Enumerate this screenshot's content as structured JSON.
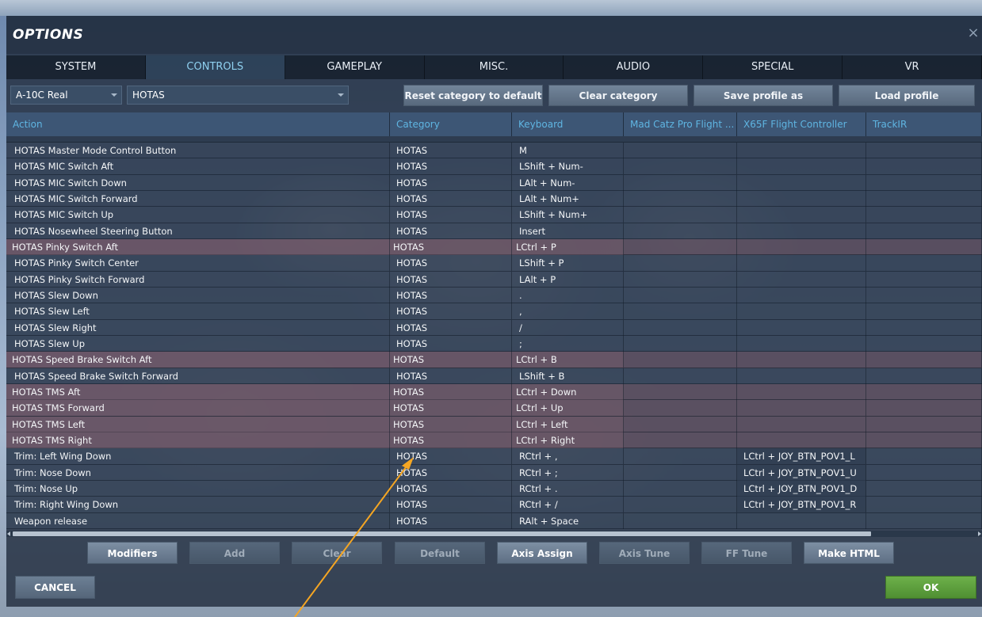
{
  "window": {
    "title": "OPTIONS",
    "close_glyph": "×"
  },
  "tabs": [
    {
      "label": "SYSTEM",
      "active": false
    },
    {
      "label": "CONTROLS",
      "active": true
    },
    {
      "label": "GAMEPLAY",
      "active": false
    },
    {
      "label": "MISC.",
      "active": false
    },
    {
      "label": "AUDIO",
      "active": false
    },
    {
      "label": "SPECIAL",
      "active": false
    },
    {
      "label": "VR",
      "active": false
    }
  ],
  "toolbar": {
    "aircraft": "A-10C Real",
    "category": "HOTAS",
    "reset_label": "Reset category to default",
    "clear_category_label": "Clear category",
    "save_profile_label": "Save profile as",
    "load_profile_label": "Load profile"
  },
  "table": {
    "columns": [
      "Action",
      "Category",
      "Keyboard",
      "Mad Catz Pro Flight ...",
      "X65F Flight Controller",
      "TrackIR"
    ],
    "rows": [
      {
        "action": "HOTAS Master Mode Control Button",
        "category": "HOTAS",
        "keyboard": "M",
        "madcatz": "",
        "x65f": "",
        "trackir": ""
      },
      {
        "action": "HOTAS MIC Switch Aft",
        "category": "HOTAS",
        "keyboard": "LShift + Num-",
        "madcatz": "",
        "x65f": "",
        "trackir": ""
      },
      {
        "action": "HOTAS MIC Switch Down",
        "category": "HOTAS",
        "keyboard": "LAlt + Num-",
        "madcatz": "",
        "x65f": "",
        "trackir": ""
      },
      {
        "action": "HOTAS MIC Switch Forward",
        "category": "HOTAS",
        "keyboard": "LAlt + Num+",
        "madcatz": "",
        "x65f": "",
        "trackir": ""
      },
      {
        "action": "HOTAS MIC Switch Up",
        "category": "HOTAS",
        "keyboard": "LShift + Num+",
        "madcatz": "",
        "x65f": "",
        "trackir": ""
      },
      {
        "action": "HOTAS Nosewheel Steering Button",
        "category": "HOTAS",
        "keyboard": "Insert",
        "madcatz": "",
        "x65f": "",
        "trackir": ""
      },
      {
        "action": "HOTAS Pinky Switch Aft",
        "category": "HOTAS",
        "keyboard": "LCtrl + P",
        "madcatz": "",
        "x65f": "",
        "trackir": "",
        "highlight": true
      },
      {
        "action": "HOTAS Pinky Switch Center",
        "category": "HOTAS",
        "keyboard": "LShift + P",
        "madcatz": "",
        "x65f": "",
        "trackir": ""
      },
      {
        "action": "HOTAS Pinky Switch Forward",
        "category": "HOTAS",
        "keyboard": "LAlt + P",
        "madcatz": "",
        "x65f": "",
        "trackir": ""
      },
      {
        "action": "HOTAS Slew Down",
        "category": "HOTAS",
        "keyboard": ".",
        "madcatz": "",
        "x65f": "",
        "trackir": ""
      },
      {
        "action": "HOTAS Slew Left",
        "category": "HOTAS",
        "keyboard": ",",
        "madcatz": "",
        "x65f": "",
        "trackir": ""
      },
      {
        "action": "HOTAS Slew Right",
        "category": "HOTAS",
        "keyboard": "/",
        "madcatz": "",
        "x65f": "",
        "trackir": ""
      },
      {
        "action": "HOTAS Slew Up",
        "category": "HOTAS",
        "keyboard": ";",
        "madcatz": "",
        "x65f": "",
        "trackir": ""
      },
      {
        "action": "HOTAS Speed Brake Switch Aft",
        "category": "HOTAS",
        "keyboard": "LCtrl + B",
        "madcatz": "",
        "x65f": "",
        "trackir": "",
        "highlight": true
      },
      {
        "action": "HOTAS Speed Brake Switch Forward",
        "category": "HOTAS",
        "keyboard": "LShift + B",
        "madcatz": "",
        "x65f": "",
        "trackir": ""
      },
      {
        "action": "HOTAS TMS Aft",
        "category": "HOTAS",
        "keyboard": "LCtrl + Down",
        "madcatz": "",
        "x65f": "",
        "trackir": "",
        "highlight": true
      },
      {
        "action": "HOTAS TMS Forward",
        "category": "HOTAS",
        "keyboard": "LCtrl + Up",
        "madcatz": "",
        "x65f": "",
        "trackir": "",
        "highlight": true
      },
      {
        "action": "HOTAS TMS Left",
        "category": "HOTAS",
        "keyboard": "LCtrl + Left",
        "madcatz": "",
        "x65f": "",
        "trackir": "",
        "highlight": true
      },
      {
        "action": "HOTAS TMS Right",
        "category": "HOTAS",
        "keyboard": "LCtrl + Right",
        "madcatz": "",
        "x65f": "",
        "trackir": "",
        "highlight": true
      },
      {
        "action": "Trim: Left Wing Down",
        "category": "HOTAS",
        "keyboard": "RCtrl + ,",
        "madcatz": "",
        "x65f": "LCtrl + JOY_BTN_POV1_L",
        "trackir": "",
        "trim": true
      },
      {
        "action": "Trim: Nose Down",
        "category": "HOTAS",
        "keyboard": "RCtrl + ;",
        "madcatz": "",
        "x65f": "LCtrl + JOY_BTN_POV1_U",
        "trackir": "",
        "trim": true
      },
      {
        "action": "Trim: Nose Up",
        "category": "HOTAS",
        "keyboard": "RCtrl + .",
        "madcatz": "",
        "x65f": "LCtrl + JOY_BTN_POV1_D",
        "trackir": "",
        "trim": true
      },
      {
        "action": "Trim: Right Wing Down",
        "category": "HOTAS",
        "keyboard": "RCtrl + /",
        "madcatz": "",
        "x65f": "LCtrl + JOY_BTN_POV1_R",
        "trackir": "",
        "trim": true
      },
      {
        "action": "Weapon release",
        "category": "HOTAS",
        "keyboard": "RAlt + Space",
        "madcatz": "",
        "x65f": "",
        "trackir": ""
      }
    ]
  },
  "actions": [
    {
      "label": "Modifiers",
      "name": "modifiers-button",
      "enabled": true
    },
    {
      "label": "Add",
      "name": "add-button",
      "enabled": false
    },
    {
      "label": "Clear",
      "name": "clear-button",
      "enabled": false
    },
    {
      "label": "Default",
      "name": "default-button",
      "enabled": false
    },
    {
      "label": "Axis Assign",
      "name": "axis-assign-button",
      "enabled": true
    },
    {
      "label": "Axis Tune",
      "name": "axis-tune-button",
      "enabled": false
    },
    {
      "label": "FF Tune",
      "name": "ff-tune-button",
      "enabled": false
    },
    {
      "label": "Make HTML",
      "name": "make-html-button",
      "enabled": true
    }
  ],
  "footer": {
    "cancel_label": "CANCEL",
    "ok_label": "OK"
  },
  "colors": {
    "accent": "#5fb5e2",
    "active_tab": "#8fd0ef",
    "ok_green": "#5aa23c",
    "annotation_arrow": "#f5a623"
  }
}
